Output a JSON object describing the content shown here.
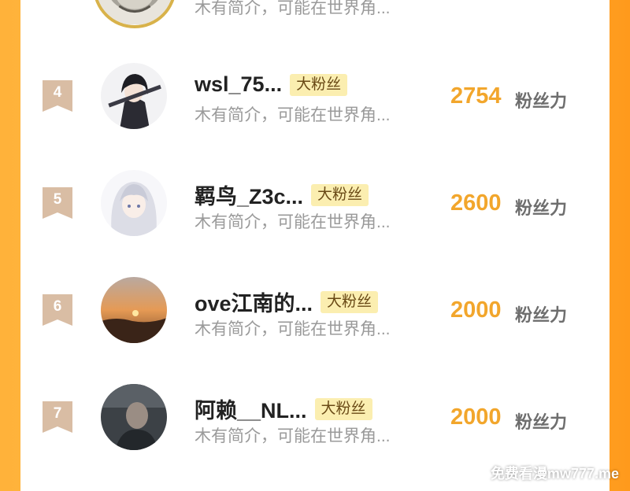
{
  "top_row": {
    "desc": "木有简介，可能在世界角..."
  },
  "fans": [
    {
      "rank": "4",
      "name": "wsl_75...",
      "badge": "大粉丝",
      "desc": "木有简介，可能在世界角...",
      "score": "2754",
      "score_label": "粉丝力",
      "avatar_icon": "anime-swordsman-avatar"
    },
    {
      "rank": "5",
      "name": "羁鸟_Z3c...",
      "badge": "大粉丝",
      "desc": "木有简介，可能在世界角...",
      "score": "2600",
      "score_label": "粉丝力",
      "avatar_icon": "anime-white-hair-avatar"
    },
    {
      "rank": "6",
      "name": "ove江南的...",
      "badge": "大粉丝",
      "desc": "木有简介，可能在世界角...",
      "score": "2000",
      "score_label": "粉丝力",
      "avatar_icon": "sunset-avatar"
    },
    {
      "rank": "7",
      "name": "阿赖__NL...",
      "badge": "大粉丝",
      "desc": "木有简介，可能在世界角...",
      "score": "2000",
      "score_label": "粉丝力",
      "avatar_icon": "person-photo-avatar"
    }
  ],
  "watermark": "免费看漫mw777.me",
  "colors": {
    "accent": "#f2a62c",
    "rank_bg": "#d9bda4",
    "badge_bg": "#fbeeb0"
  }
}
